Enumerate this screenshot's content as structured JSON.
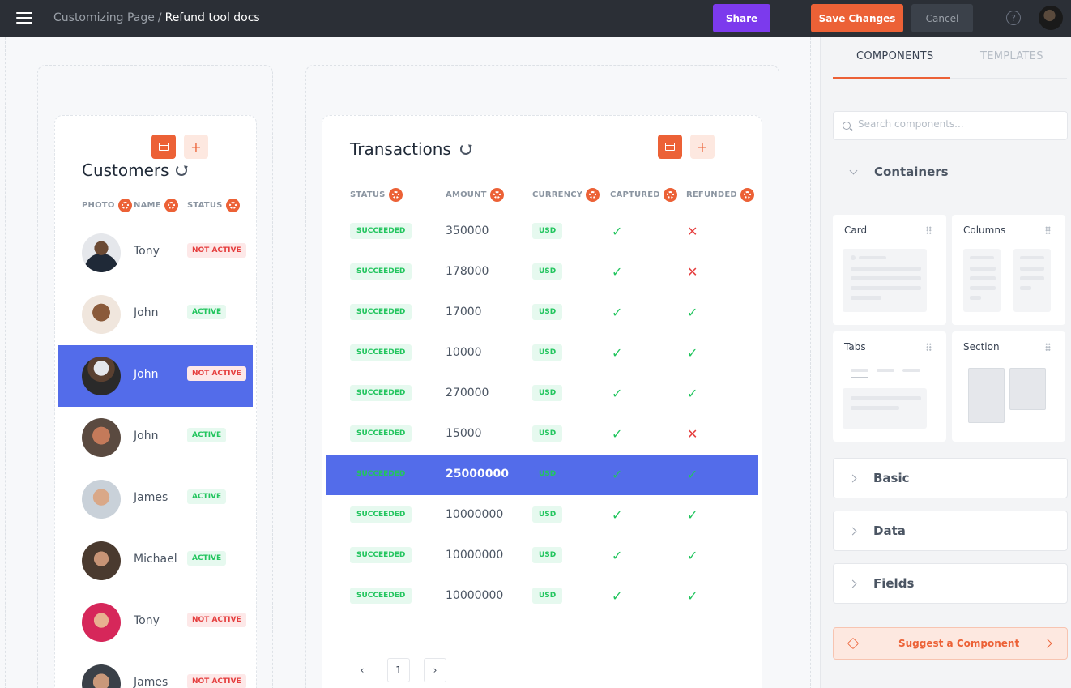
{
  "header": {
    "breadcrumb_parent": "Customizing Page",
    "breadcrumb_sep": "/",
    "breadcrumb_current": "Refund tool docs",
    "share_label": "Share",
    "save_label": "Save Changes",
    "cancel_label": "Cancel",
    "help_glyph": "?"
  },
  "customers": {
    "title": "Customers",
    "columns": [
      "PHOTO",
      "NAME",
      "STATUS"
    ],
    "rows": [
      {
        "name": "Tony",
        "status": "NOT ACTIVE",
        "active": false,
        "selected": false
      },
      {
        "name": "John",
        "status": "ACTIVE",
        "active": true,
        "selected": false
      },
      {
        "name": "John",
        "status": "NOT ACTIVE",
        "active": false,
        "selected": true
      },
      {
        "name": "John",
        "status": "ACTIVE",
        "active": true,
        "selected": false
      },
      {
        "name": "James",
        "status": "ACTIVE",
        "active": true,
        "selected": false
      },
      {
        "name": "Michael",
        "status": "ACTIVE",
        "active": true,
        "selected": false
      },
      {
        "name": "Tony",
        "status": "NOT ACTIVE",
        "active": false,
        "selected": false
      },
      {
        "name": "James",
        "status": "NOT ACTIVE",
        "active": false,
        "selected": false
      }
    ]
  },
  "transactions": {
    "title": "Transactions",
    "columns": [
      "STATUS",
      "AMOUNT",
      "CURRENCY",
      "CAPTURED",
      "REFUNDED"
    ],
    "rows": [
      {
        "status": "SUCCEEDED",
        "amount": "350000",
        "currency": "USD",
        "captured": true,
        "refunded": false,
        "selected": false
      },
      {
        "status": "SUCCEEDED",
        "amount": "178000",
        "currency": "USD",
        "captured": true,
        "refunded": false,
        "selected": false
      },
      {
        "status": "SUCCEEDED",
        "amount": "17000",
        "currency": "USD",
        "captured": true,
        "refunded": true,
        "selected": false
      },
      {
        "status": "SUCCEEDED",
        "amount": "10000",
        "currency": "USD",
        "captured": true,
        "refunded": true,
        "selected": false
      },
      {
        "status": "SUCCEEDED",
        "amount": "270000",
        "currency": "USD",
        "captured": true,
        "refunded": true,
        "selected": false
      },
      {
        "status": "SUCCEEDED",
        "amount": "15000",
        "currency": "USD",
        "captured": true,
        "refunded": false,
        "selected": false
      },
      {
        "status": "SUCCEEDED",
        "amount": "25000000",
        "currency": "USD",
        "captured": true,
        "refunded": true,
        "selected": true
      },
      {
        "status": "SUCCEEDED",
        "amount": "10000000",
        "currency": "USD",
        "captured": true,
        "refunded": true,
        "selected": false
      },
      {
        "status": "SUCCEEDED",
        "amount": "10000000",
        "currency": "USD",
        "captured": true,
        "refunded": true,
        "selected": false
      },
      {
        "status": "SUCCEEDED",
        "amount": "10000000",
        "currency": "USD",
        "captured": true,
        "refunded": true,
        "selected": false
      }
    ],
    "pagination": {
      "prev": "‹",
      "page": "1",
      "next": "›"
    }
  },
  "panel": {
    "tabs": [
      "COMPONENTS",
      "TEMPLATES"
    ],
    "search_placeholder": "Search components...",
    "sections": {
      "containers": "Containers",
      "basic": "Basic",
      "data": "Data",
      "fields": "Fields"
    },
    "components": [
      "Card",
      "Columns",
      "Tabs",
      "Section"
    ],
    "suggest_label": "Suggest a Component"
  },
  "colors": {
    "accent": "#ec6136",
    "share": "#7c3aed",
    "selection": "#536cea",
    "active_green": "#22c55e",
    "inactive_red": "#e53e3e"
  },
  "icons": {
    "check": "✓",
    "cross": "✕",
    "plus": "+"
  }
}
